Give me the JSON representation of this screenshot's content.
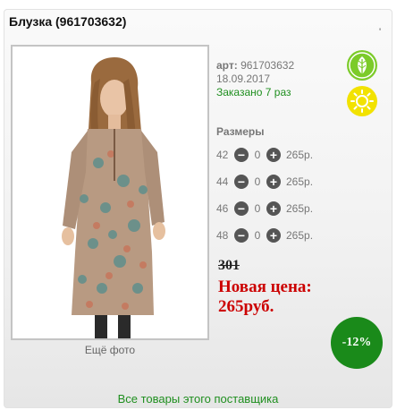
{
  "product": {
    "title": "Блузка (961703632)",
    "title_mark": "'",
    "more_photo": "Ещё фото",
    "article_label": "арт:",
    "article": "961703632",
    "date": "18.09.2017",
    "ordered": "Заказано 7 раз",
    "sizes_title": "Размеры",
    "sizes": [
      {
        "size": "42",
        "qty": "0",
        "price": "265р."
      },
      {
        "size": "44",
        "qty": "0",
        "price": "265р."
      },
      {
        "size": "46",
        "qty": "0",
        "price": "265р."
      },
      {
        "size": "48",
        "qty": "0",
        "price": "265р."
      }
    ],
    "old_price": "301",
    "new_price_label": "Новая цена:",
    "new_price": "265руб.",
    "discount": "-12%",
    "supplier_link": "Все товары этого поставщика"
  },
  "icons": {
    "minus": "−",
    "plus": "+"
  },
  "colors": {
    "accent_green": "#1f8f1f",
    "price_red": "#cc0000",
    "discount_bg": "#1a8a1a",
    "leaf_badge": "#7ccb2a",
    "sun_badge": "#f2e200"
  }
}
